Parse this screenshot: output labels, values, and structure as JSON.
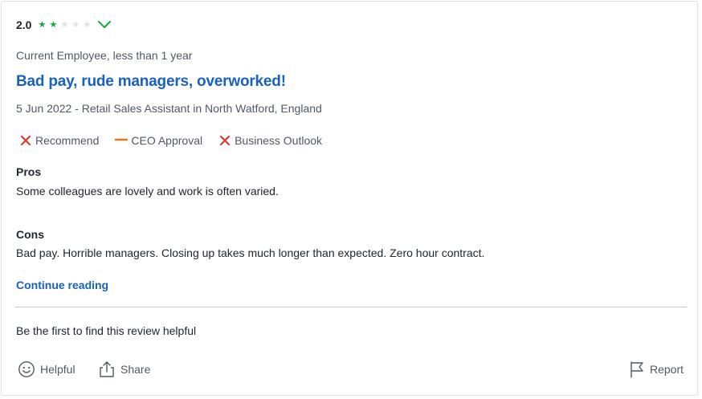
{
  "review": {
    "rating": "2.0",
    "stars_filled": 2,
    "stars_total": 5,
    "employee_status": "Current Employee, less than 1 year",
    "title": "Bad pay, rude managers, overworked!",
    "meta": "5 Jun 2022 - Retail Sales Assistant in North Watford, England",
    "ratings": {
      "recommend": "Recommend",
      "ceo": "CEO Approval",
      "outlook": "Business Outlook"
    },
    "pros_label": "Pros",
    "pros_text": "Some colleagues are lovely and work is often varied.",
    "cons_label": "Cons",
    "cons_text": "Bad pay. Horrible managers. Closing up takes much longer than expected. Zero hour contract.",
    "continue_label": "Continue reading",
    "helpful_note": "Be the first to find this review helpful",
    "actions": {
      "helpful": "Helpful",
      "share": "Share",
      "report": "Report"
    }
  },
  "colors": {
    "accent_blue": "#1861bf",
    "star_green": "#0caa41",
    "negative_red": "#e03b2c",
    "neutral_orange": "#e8771a"
  },
  "icons": {
    "star": "star-icon",
    "chevron": "chevron-down-icon",
    "negative": "x-icon",
    "neutral": "dash-icon",
    "helpful": "smiley-icon",
    "share": "share-icon",
    "report": "flag-icon"
  }
}
